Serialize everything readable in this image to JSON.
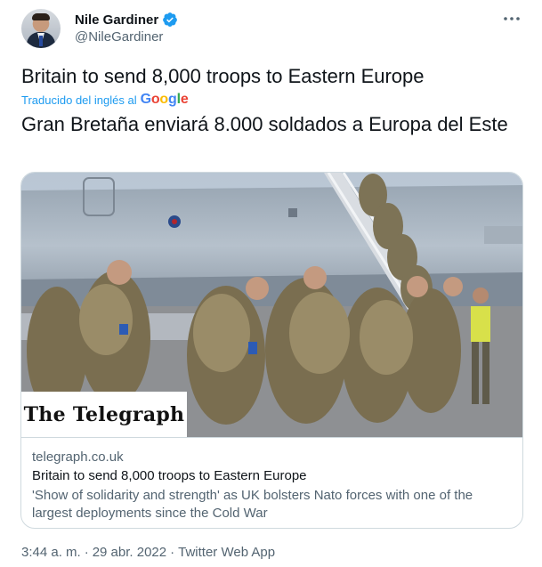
{
  "author": {
    "display_name": "Nile Gardiner",
    "handle": "@NileGardiner",
    "verified": true
  },
  "tweet": {
    "original_text": "Britain to send 8,000 troops to Eastern Europe",
    "translated_from": "Traducido del inglés al",
    "translator_logo": "Google",
    "translated_text": "Gran Bretaña enviará 8.000 soldados a Europa del Este"
  },
  "card": {
    "image_masthead": "The Telegraph",
    "domain": "telegraph.co.uk",
    "title": "Britain to send 8,000 troops to Eastern Europe",
    "description": "'Show of solidarity and strength' as UK bolsters Nato forces with one of the largest deployments since the Cold War"
  },
  "meta": {
    "time": "3:44 a. m.",
    "separator": "·",
    "date": "29 abr. 2022",
    "client": "Twitter Web App"
  },
  "icons": {
    "verified": "verified-badge-icon",
    "more": "more-options-icon"
  },
  "colors": {
    "accent": "#1d9bf0",
    "text_primary": "#0f1419",
    "text_secondary": "#536471",
    "border": "#cfd9de"
  }
}
